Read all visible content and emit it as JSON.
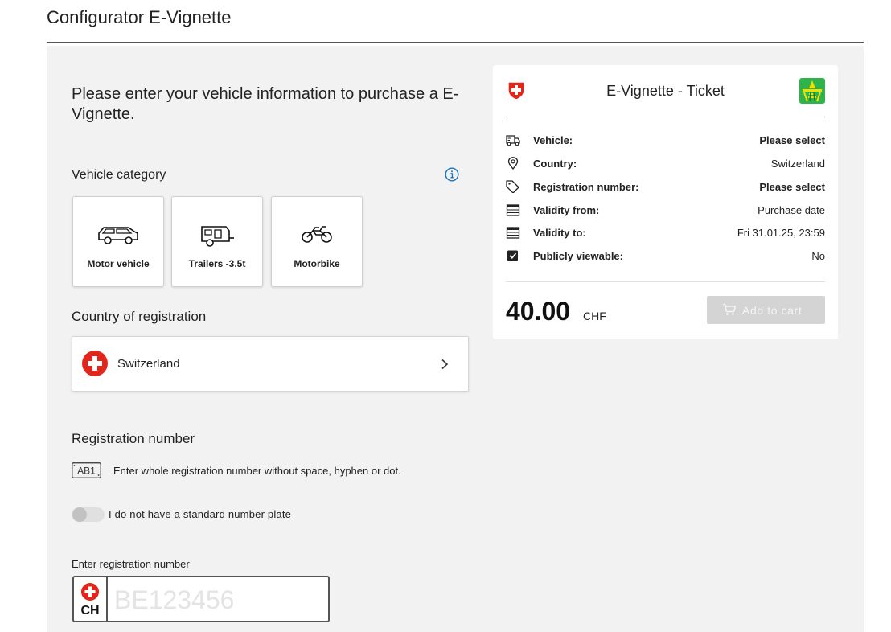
{
  "page": {
    "title": "Configurator E-Vignette"
  },
  "form": {
    "intro": "Please enter your vehicle information to purchase a E-Vignette.",
    "vehicle_category": {
      "label": "Vehicle category",
      "options": [
        {
          "label": "Motor vehicle",
          "icon": "car-icon"
        },
        {
          "label": "Trailers -3.5t",
          "icon": "trailer-icon"
        },
        {
          "label": "Motorbike",
          "icon": "motorbike-icon"
        }
      ]
    },
    "country": {
      "label": "Country of registration",
      "selected": "Switzerland",
      "flag_color": "#e1261c"
    },
    "registration": {
      "label": "Registration number",
      "plate_icon_text": "AB1",
      "hint": "Enter whole registration number without space, hyphen or dot.",
      "toggle_label": "I do not have a standard number plate",
      "toggle_on": false,
      "field_label": "Enter registration number",
      "country_code": "CH",
      "placeholder": "BE123456",
      "value": ""
    }
  },
  "ticket": {
    "title": "E-Vignette - Ticket",
    "rows": [
      {
        "label": "Vehicle:",
        "value": "Please select",
        "icon": "truck-icon"
      },
      {
        "label": "Country:",
        "value": "Switzerland",
        "icon": "location-pin-icon"
      },
      {
        "label": "Registration number:",
        "value": "Please select",
        "icon": "tag-icon"
      },
      {
        "label": "Validity from:",
        "value": "Purchase date",
        "icon": "calendar-icon"
      },
      {
        "label": "Validity to:",
        "value": "Fri 31.01.25, 23:59",
        "icon": "calendar-icon"
      },
      {
        "label": "Publicly viewable:",
        "value": "No",
        "icon": "checkbox-checked-icon"
      }
    ],
    "price": "40.00",
    "currency": "CHF",
    "add_to_cart": "Add to cart",
    "colors": {
      "swiss_red": "#e1261c",
      "astra_green": "#2fb34a",
      "astra_yellow": "#f0e000",
      "disabled_button": "#d4d4d4"
    }
  }
}
